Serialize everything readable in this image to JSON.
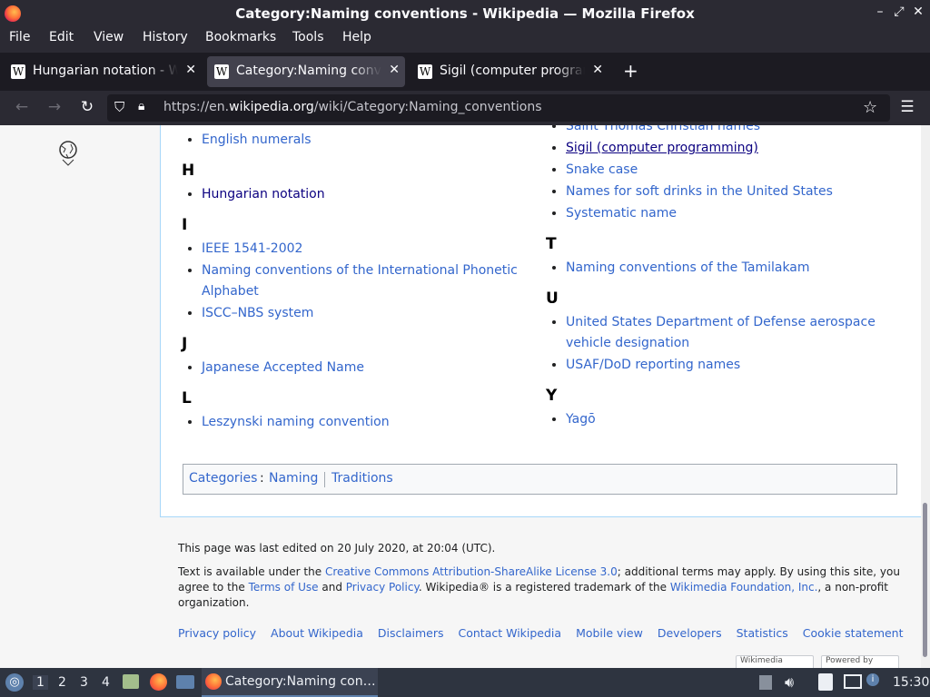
{
  "window": {
    "title": "Category:Naming conventions - Wikipedia — Mozilla Firefox"
  },
  "menu": [
    "File",
    "Edit",
    "View",
    "History",
    "Bookmarks",
    "Tools",
    "Help"
  ],
  "tabs": [
    {
      "label": "Hungarian notation - Wikipedia",
      "active": false
    },
    {
      "label": "Category:Naming conventions - Wikipedia",
      "active": true
    },
    {
      "label": "Sigil (computer programming) - Wikipedia",
      "active": false
    }
  ],
  "address": {
    "prefix": "https://en.",
    "domain": "wikipedia.org",
    "path": "/wiki/Category:Naming_conventions"
  },
  "left_col": [
    {
      "letter": "",
      "items": [
        {
          "text": "English numerals",
          "visited": false
        }
      ]
    },
    {
      "letter": "H",
      "items": [
        {
          "text": "Hungarian notation",
          "visited": true
        }
      ]
    },
    {
      "letter": "I",
      "items": [
        {
          "text": "IEEE 1541-2002",
          "visited": false
        },
        {
          "text": "Naming conventions of the International Phonetic Alphabet",
          "visited": false
        },
        {
          "text": "ISCC–NBS system",
          "visited": false
        }
      ]
    },
    {
      "letter": "J",
      "items": [
        {
          "text": "Japanese Accepted Name",
          "visited": false
        }
      ]
    },
    {
      "letter": "L",
      "items": [
        {
          "text": "Leszynski naming convention",
          "visited": false
        }
      ]
    }
  ],
  "right_col": [
    {
      "letter": "",
      "items": [
        {
          "text": "Saint Thomas Christian names",
          "visited": false
        },
        {
          "text": "Sigil (computer programming)",
          "visited": true,
          "underline": true
        },
        {
          "text": "Snake case",
          "visited": false
        },
        {
          "text": "Names for soft drinks in the United States",
          "visited": false
        },
        {
          "text": "Systematic name",
          "visited": false
        }
      ]
    },
    {
      "letter": "T",
      "items": [
        {
          "text": "Naming conventions of the Tamilakam",
          "visited": false
        }
      ]
    },
    {
      "letter": "U",
      "items": [
        {
          "text": "United States Department of Defense aerospace vehicle designation",
          "visited": false
        },
        {
          "text": "USAF/DoD reporting names",
          "visited": false
        }
      ]
    },
    {
      "letter": "Y",
      "items": [
        {
          "text": "Yagō",
          "visited": false
        }
      ]
    }
  ],
  "categories": {
    "label": "Categories",
    "items": [
      "Naming",
      "Traditions"
    ]
  },
  "footer": {
    "last_edited": "This page was last edited on 20 July 2020, at 20:04 (UTC).",
    "license_1": "Text is available under the ",
    "license_link": "Creative Commons Attribution-ShareAlike License 3.0",
    "license_2": "; additional terms may apply. By using this site, you agree to the ",
    "terms": "Terms of Use",
    "and": " and ",
    "privacy": "Privacy Policy",
    "license_3": ". Wikipedia® is a registered trademark of the ",
    "wmf": "Wikimedia Foundation, Inc.",
    "license_4": ", a non-profit organization.",
    "places": [
      "Privacy policy",
      "About Wikipedia",
      "Disclaimers",
      "Contact Wikipedia",
      "Mobile view",
      "Developers",
      "Statistics",
      "Cookie statement"
    ],
    "badges": [
      "Wikimedia",
      "Powered by"
    ]
  },
  "taskbar": {
    "workspaces": [
      "1",
      "2",
      "3",
      "4"
    ],
    "task_title": "Category:Naming con…",
    "clock": "15:30"
  },
  "colors": {
    "link": "#3366cc",
    "visited": "#0b0080",
    "chrome": "#2b2a33",
    "taskbar": "#2e3440"
  }
}
